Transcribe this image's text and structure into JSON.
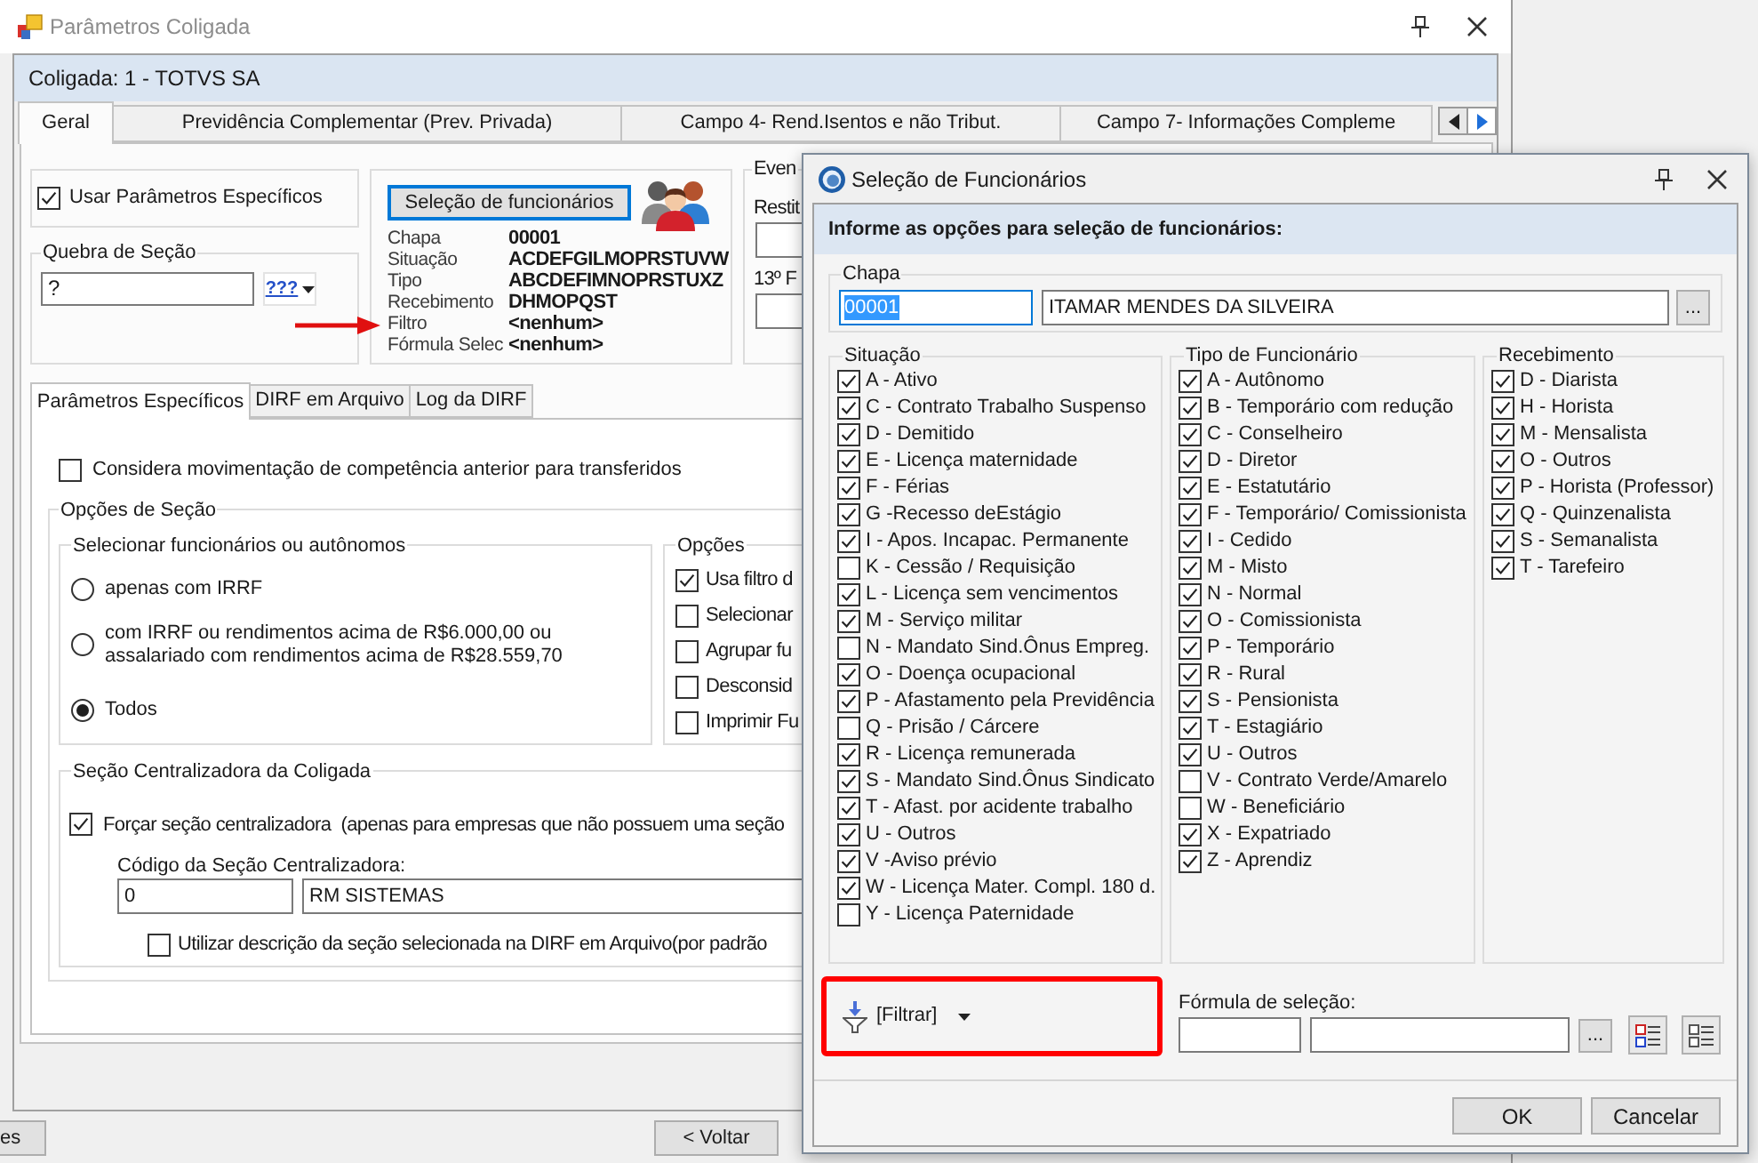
{
  "window": {
    "title": "Parâmetros Coligada"
  },
  "header": {
    "title": "Coligada: 1 - TOTVS SA"
  },
  "tabs": [
    {
      "label": "Geral",
      "selected": true
    },
    {
      "label": "Previdência Complementar (Prev. Privada)",
      "selected": false
    },
    {
      "label": "Campo 4- Rend.Isentos e não Tribut.",
      "selected": false
    },
    {
      "label": "Campo 7- Informações Compleme",
      "selected": false
    }
  ],
  "general": {
    "specific_params": {
      "label": "Usar Parâmetros Específicos",
      "checked": true
    },
    "section_break": {
      "legend": "Quebra de Seção",
      "value": "?",
      "lookup_label": "???"
    },
    "employee_selection": {
      "button": {
        "label": "Seleção de funcionários",
        "focused": true
      },
      "summary": [
        {
          "label": "Chapa",
          "value": "00001"
        },
        {
          "label": "Situação",
          "value": "ACDEFGILMOPRSTUVW"
        },
        {
          "label": "Tipo",
          "value": "ABCDEFIMNOPRSTUXZ"
        },
        {
          "label": "Recebimento",
          "value": "DHMOPQST"
        },
        {
          "label": "Filtro",
          "value": "<nenhum>"
        },
        {
          "label": "Fórmula Selec",
          "value": "<nenhum>"
        }
      ]
    },
    "events": {
      "legend": "Even",
      "fields": [
        {
          "label": "Restit"
        },
        {
          "label": "13º F"
        }
      ]
    }
  },
  "sub_tabs": [
    {
      "label": "Parâmetros Específicos",
      "selected": true
    },
    {
      "label": "DIRF em Arquivo",
      "selected": false
    },
    {
      "label": "Log da DIRF",
      "selected": false
    }
  ],
  "transfer_option": {
    "label": "Considera movimentação de competência anterior para transferidos",
    "checked": false
  },
  "selection_options": {
    "legend": "Opções de Seção",
    "employee_filter": {
      "legend": "Selecionar funcionários ou autônomos",
      "options": [
        {
          "label": "apenas com IRRF",
          "selected": false
        },
        {
          "label": "com IRRF ou rendimentos acima de R$6.000,00 ou\nassalariado com rendimentos acima de R$28.559,70",
          "selected": false
        },
        {
          "label": "Todos",
          "selected": true
        }
      ]
    },
    "options": {
      "legend": "Opções",
      "items": [
        {
          "label": "Usa filtro d",
          "checked": true
        },
        {
          "label": "Selecionar",
          "checked": false
        },
        {
          "label": "Agrupar fu",
          "checked": false
        },
        {
          "label": "Desconsid",
          "checked": false
        },
        {
          "label": "Imprimir Fu",
          "checked": false
        }
      ]
    },
    "central_section": {
      "legend": "Seção Centralizadora da Coligada",
      "force": {
        "label": "Forçar seção centralizadora  (apenas para empresas que não possuem uma seção",
        "checked": true
      },
      "code_label": "Código da Seção Centralizadora:",
      "code": "0",
      "name": "RM SISTEMAS",
      "use_description": {
        "label": "Utilizar descrição da seção selecionada na DIRF em Arquivo(por padrão",
        "checked": false
      }
    }
  },
  "footer_buttons": [
    {
      "label": "es"
    },
    {
      "label": "< Voltar"
    }
  ],
  "dialog": {
    "title": "Seleção de Funcionários",
    "header": "Informe as opções para seleção de funcionários:",
    "employee": {
      "legend": "Chapa",
      "code": "00001",
      "code_highlighted": true,
      "name": "ITAMAR MENDES DA SILVEIRA",
      "browse_label": "..."
    },
    "groups": [
      {
        "legend": "Situação",
        "items": [
          {
            "label": "A - Ativo",
            "checked": true
          },
          {
            "label": "C - Contrato Trabalho Suspenso",
            "checked": true
          },
          {
            "label": "D - Demitido",
            "checked": true
          },
          {
            "label": "E - Licença maternidade",
            "checked": true
          },
          {
            "label": "F - Férias",
            "checked": true
          },
          {
            "label": "G -Recesso deEstágio",
            "checked": true
          },
          {
            "label": "I - Apos. Incapac. Permanente",
            "checked": true
          },
          {
            "label": "K - Cessão / Requisição",
            "checked": false
          },
          {
            "label": "L - Licença sem vencimentos",
            "checked": true
          },
          {
            "label": "M - Serviço militar",
            "checked": true
          },
          {
            "label": "N - Mandato Sind.Ônus Empreg.",
            "checked": false
          },
          {
            "label": "O - Doença ocupacional",
            "checked": true
          },
          {
            "label": "P - Afastamento pela Previdência",
            "checked": true
          },
          {
            "label": "Q - Prisão / Cárcere",
            "checked": false
          },
          {
            "label": "R - Licença remunerada",
            "checked": true
          },
          {
            "label": "S - Mandato Sind.Ônus Sindicato",
            "checked": true
          },
          {
            "label": "T - Afast. por acidente trabalho",
            "checked": true
          },
          {
            "label": "U - Outros",
            "checked": true
          },
          {
            "label": "V -Aviso prévio",
            "checked": true
          },
          {
            "label": "W - Licença Mater. Compl. 180 d.",
            "checked": true
          },
          {
            "label": "Y - Licença Paternidade",
            "checked": false
          }
        ]
      },
      {
        "legend": "Tipo de Funcionário",
        "items": [
          {
            "label": "A - Autônomo",
            "checked": true
          },
          {
            "label": "B - Temporário com redução",
            "checked": true
          },
          {
            "label": "C - Conselheiro",
            "checked": true
          },
          {
            "label": "D - Diretor",
            "checked": true
          },
          {
            "label": "E - Estatutário",
            "checked": true
          },
          {
            "label": "F - Temporário/ Comissionista",
            "checked": true
          },
          {
            "label": "I - Cedido",
            "checked": true
          },
          {
            "label": "M - Misto",
            "checked": true
          },
          {
            "label": "N - Normal",
            "checked": true
          },
          {
            "label": "O - Comissionista",
            "checked": true
          },
          {
            "label": "P - Temporário",
            "checked": true
          },
          {
            "label": "R - Rural",
            "checked": true
          },
          {
            "label": "S - Pensionista",
            "checked": true
          },
          {
            "label": "T - Estagiário",
            "checked": true
          },
          {
            "label": "U - Outros",
            "checked": true
          },
          {
            "label": "V - Contrato Verde/Amarelo",
            "checked": false
          },
          {
            "label": "W - Beneficiário",
            "checked": false
          },
          {
            "label": "X - Expatriado",
            "checked": true
          },
          {
            "label": "Z - Aprendiz",
            "checked": true
          }
        ]
      },
      {
        "legend": "Recebimento",
        "items": [
          {
            "label": "D - Diarista",
            "checked": true
          },
          {
            "label": "H - Horista",
            "checked": true
          },
          {
            "label": "M - Mensalista",
            "checked": true
          },
          {
            "label": "O - Outros",
            "checked": true
          },
          {
            "label": "P - Horista (Professor)",
            "checked": true
          },
          {
            "label": "Q - Quinzenalista",
            "checked": true
          },
          {
            "label": "S - Semanalista",
            "checked": true
          },
          {
            "label": "T - Tarefeiro",
            "checked": true
          }
        ]
      }
    ],
    "filter": {
      "label": "[Filtrar]"
    },
    "formula": {
      "label": "Fórmula de seleção:",
      "browse_label": "..."
    },
    "buttons": [
      {
        "label": "OK"
      },
      {
        "label": "Cancelar"
      }
    ]
  }
}
